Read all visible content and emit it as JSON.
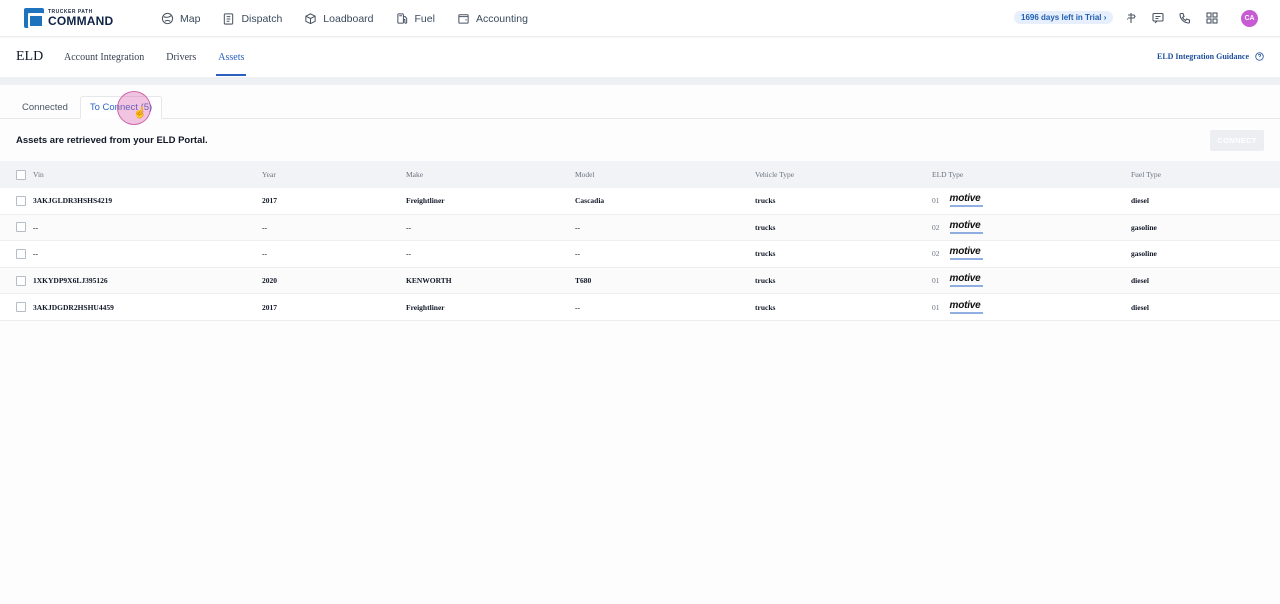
{
  "brand": {
    "small": "TRUCKER PATH",
    "big": "COMMAND"
  },
  "nav": [
    {
      "label": "Map",
      "icon": "map-icon"
    },
    {
      "label": "Dispatch",
      "icon": "clipboard-icon"
    },
    {
      "label": "Loadboard",
      "icon": "box-icon"
    },
    {
      "label": "Fuel",
      "icon": "fuel-icon"
    },
    {
      "label": "Accounting",
      "icon": "wallet-icon"
    }
  ],
  "trial": "1696 days left in Trial ›",
  "avatar": "CA",
  "page": {
    "title": "ELD",
    "tabs": [
      "Account Integration",
      "Drivers",
      "Assets"
    ],
    "active_tab": "Assets",
    "guidance": "ELD Integration Guidance"
  },
  "inner_tabs": {
    "connected": "Connected",
    "to_connect": "To Connect (5)"
  },
  "info": "Assets are retrieved from your ELD Portal.",
  "connect_label": "CONNECT",
  "table": {
    "headers": [
      "Vin",
      "Year",
      "Make",
      "Model",
      "Vehicle Type",
      "ELD Type",
      "Fuel Type"
    ],
    "eld_brand": "motive",
    "rows": [
      {
        "vin": "3AKJGLDR3HSHS4219",
        "year": "2017",
        "make": "Freightliner",
        "model": "Cascadia",
        "vtype": "trucks",
        "eld_num": "01",
        "fuel": "diesel"
      },
      {
        "vin": "--",
        "year": "--",
        "make": "--",
        "model": "--",
        "vtype": "trucks",
        "eld_num": "02",
        "fuel": "gasoline"
      },
      {
        "vin": "--",
        "year": "--",
        "make": "--",
        "model": "--",
        "vtype": "trucks",
        "eld_num": "02",
        "fuel": "gasoline"
      },
      {
        "vin": "1XKYDP9X6LJ395126",
        "year": "2020",
        "make": "KENWORTH",
        "model": "T680",
        "vtype": "trucks",
        "eld_num": "01",
        "fuel": "diesel"
      },
      {
        "vin": "3AKJDGDR2HSHU4459",
        "year": "2017",
        "make": "Freightliner",
        "model": "--",
        "vtype": "trucks",
        "eld_num": "01",
        "fuel": "diesel"
      }
    ]
  },
  "colors": {
    "accent": "#2a5fbf",
    "brand": "#1e73be",
    "avatar": "#c65bd4"
  }
}
